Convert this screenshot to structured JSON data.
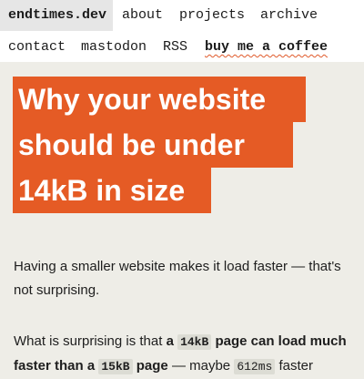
{
  "nav": {
    "brand": "endtimes.dev",
    "row1": [
      "about",
      "projects",
      "archive"
    ],
    "row2": [
      "contact",
      "mastodon",
      "RSS"
    ],
    "coffee": "buy me a coffee",
    "accent": "#e05a2b"
  },
  "article": {
    "title_lines": [
      "Why your website",
      "should be under",
      "14kB in size"
    ],
    "title_bg": "#e55b25",
    "p1": "Having a smaller website makes it load faster — that's not surprising.",
    "p2": {
      "prefix": "What is surprising is that ",
      "bold1_prefix": "a ",
      "code1": "14kB",
      "bold1_suffix": " page can load much faster than a ",
      "code2": "15kB",
      "bold2_suffix": " page",
      "mid": " — maybe ",
      "code3": "612ms",
      "suffix": " faster"
    }
  }
}
